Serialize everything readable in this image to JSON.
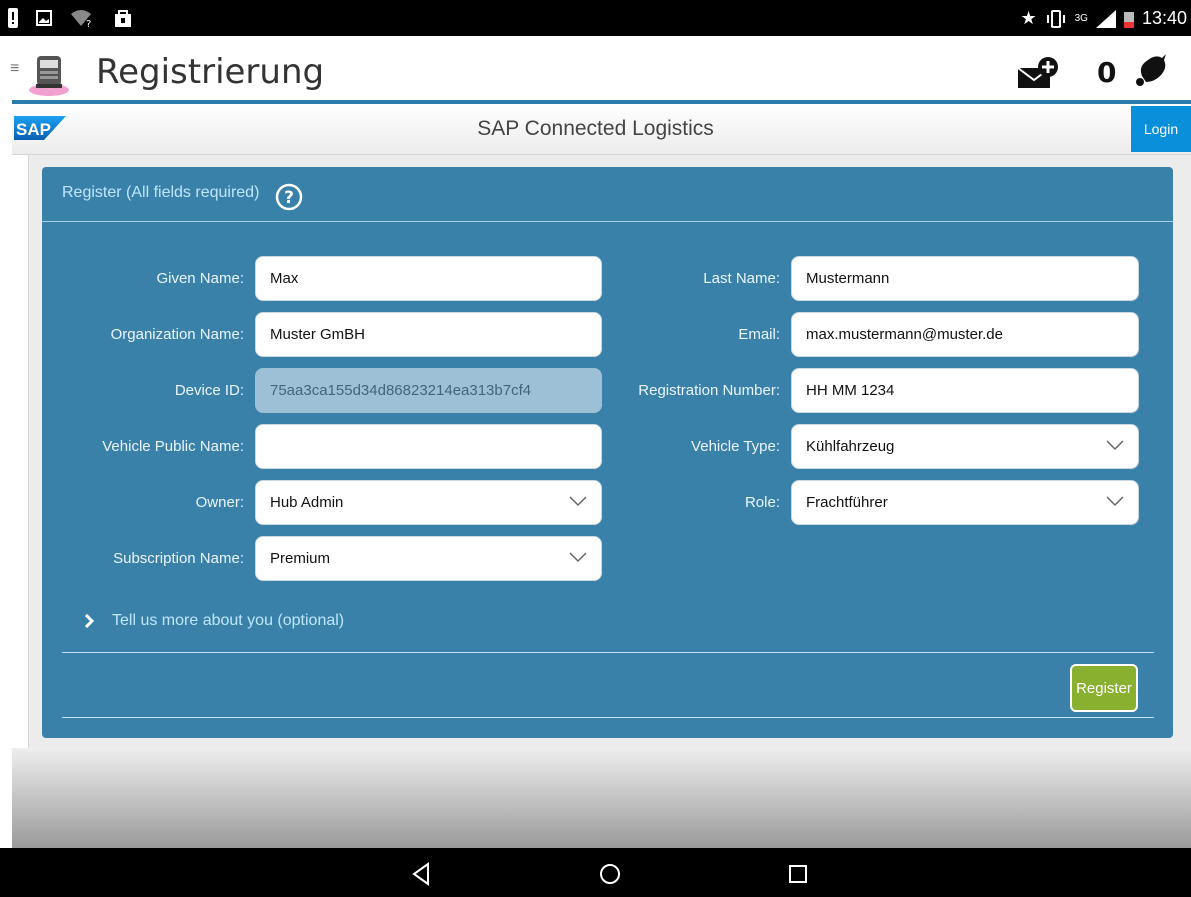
{
  "statusbar": {
    "time": "13:40",
    "signal": "3G"
  },
  "appbar": {
    "title": "Registrierung",
    "notification_count": "0"
  },
  "header": {
    "brand": "SAP",
    "title": "SAP Connected Logistics",
    "login_label": "Login"
  },
  "form": {
    "heading": "Register (All fields required)",
    "left": [
      {
        "label": "Given Name:",
        "value": "Max",
        "type": "text"
      },
      {
        "label": "Organization Name:",
        "value": "Muster GmBH",
        "type": "text"
      },
      {
        "label": "Device ID:",
        "value": "75aa3ca155d34d86823214ea313b7cf4",
        "type": "readonly"
      },
      {
        "label": "Vehicle Public Name:",
        "value": "",
        "type": "text"
      },
      {
        "label": "Owner:",
        "value": "Hub Admin",
        "type": "select"
      },
      {
        "label": "Subscription Name:",
        "value": "Premium",
        "type": "select"
      }
    ],
    "right": [
      {
        "label": "Last Name:",
        "value": "Mustermann",
        "type": "text"
      },
      {
        "label": "Email:",
        "value": "max.mustermann@muster.de",
        "type": "text"
      },
      {
        "label": "Registration Number:",
        "value": "HH MM 1234",
        "type": "text"
      },
      {
        "label": "Vehicle Type:",
        "value": "Kühlfahrzeug",
        "type": "select"
      },
      {
        "label": "Role:",
        "value": "Frachtführer",
        "type": "select"
      }
    ],
    "more_label": "Tell us more about you (optional)",
    "submit_label": "Register"
  },
  "colors": {
    "panel": "#3a81aa",
    "accent": "#0a8fdb",
    "submit": "#8ab030"
  }
}
